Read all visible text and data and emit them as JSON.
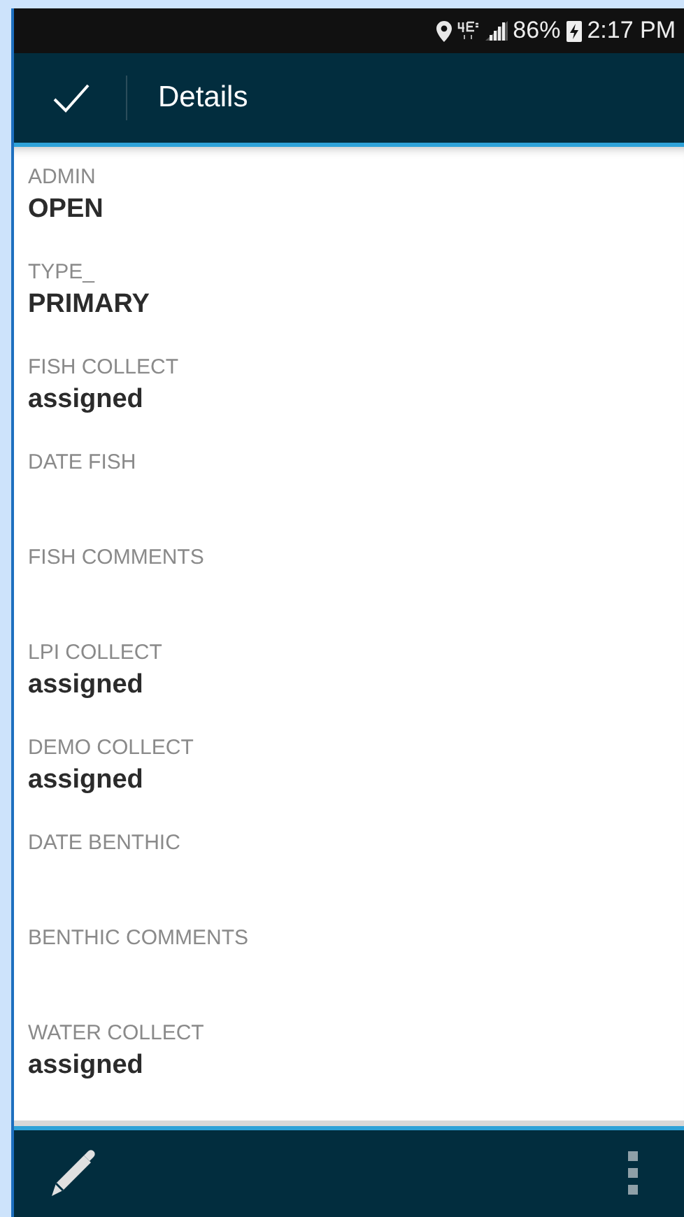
{
  "status_bar": {
    "battery": "86%",
    "time": "2:17 PM"
  },
  "app_bar": {
    "title": "Details"
  },
  "fields": [
    {
      "label": "ADMIN",
      "value": "OPEN"
    },
    {
      "label": "TYPE_",
      "value": "PRIMARY"
    },
    {
      "label": "FISH COLLECT",
      "value": "assigned"
    },
    {
      "label": "DATE FISH"
    },
    {
      "label": "FISH COMMENTS"
    },
    {
      "label": "LPI COLLECT",
      "value": "assigned"
    },
    {
      "label": "DEMO COLLECT",
      "value": "assigned"
    },
    {
      "label": "DATE BENTHIC"
    },
    {
      "label": "BENTHIC COMMENTS"
    },
    {
      "label": "WATER COLLECT",
      "value": "assigned"
    }
  ]
}
